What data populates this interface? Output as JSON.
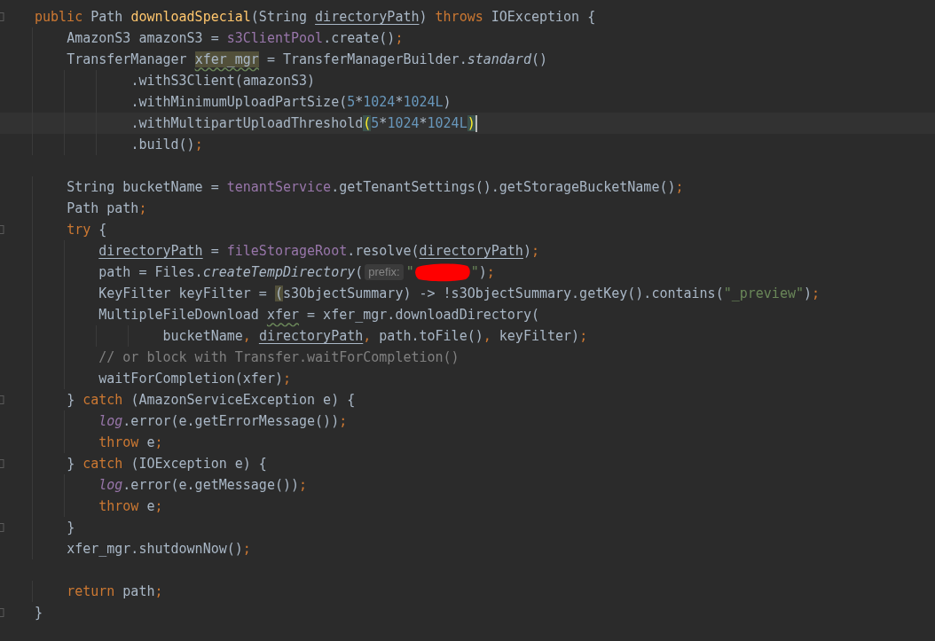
{
  "editor": {
    "lines": [
      {
        "current": false,
        "fold": true,
        "tokens": [
          {
            "kind": "keyword",
            "text": "public"
          },
          {
            "kind": "plain",
            "text": " Path "
          },
          {
            "kind": "declaration",
            "text": "downloadSpecial"
          },
          {
            "kind": "plain",
            "text": "(String "
          },
          {
            "kind": "parameter",
            "text": "directoryPath"
          },
          {
            "kind": "plain",
            "text": ") "
          },
          {
            "kind": "keyword",
            "text": "throws"
          },
          {
            "kind": "plain",
            "text": " IOException {"
          }
        ]
      },
      {
        "current": false,
        "fold": false,
        "tokens": [
          {
            "kind": "plain",
            "text": "    AmazonS3 amazonS3 = "
          },
          {
            "kind": "field",
            "text": "s3ClientPool"
          },
          {
            "kind": "plain",
            "text": ".create()"
          },
          {
            "kind": "punct",
            "text": ";"
          }
        ]
      },
      {
        "current": false,
        "fold": false,
        "tokens": [
          {
            "kind": "plain",
            "text": "    TransferManager "
          },
          {
            "kind": "occurrence",
            "text": "xfer_mgr"
          },
          {
            "kind": "plain",
            "text": " = TransferManagerBuilder."
          },
          {
            "kind": "static",
            "text": "standard"
          },
          {
            "kind": "plain",
            "text": "()"
          }
        ]
      },
      {
        "current": false,
        "fold": false,
        "tokens": [
          {
            "kind": "plain",
            "text": "            .withS3Client(amazonS3)"
          }
        ]
      },
      {
        "current": false,
        "fold": false,
        "tokens": [
          {
            "kind": "plain",
            "text": "            .withMinimumUploadPartSize("
          },
          {
            "kind": "number",
            "text": "5"
          },
          {
            "kind": "plain",
            "text": "*"
          },
          {
            "kind": "number",
            "text": "1024"
          },
          {
            "kind": "plain",
            "text": "*"
          },
          {
            "kind": "number",
            "text": "1024L"
          },
          {
            "kind": "plain",
            "text": ")"
          }
        ]
      },
      {
        "current": true,
        "fold": false,
        "tokens": [
          {
            "kind": "plain",
            "text": "            .withMultipartUploadThreshold"
          },
          {
            "kind": "brace-match",
            "text": "("
          },
          {
            "kind": "number",
            "text": "5"
          },
          {
            "kind": "plain",
            "text": "*"
          },
          {
            "kind": "number",
            "text": "1024"
          },
          {
            "kind": "plain",
            "text": "*"
          },
          {
            "kind": "number",
            "text": "1024L"
          },
          {
            "kind": "brace-match",
            "text": ")"
          }
        ]
      },
      {
        "current": false,
        "fold": false,
        "tokens": [
          {
            "kind": "plain",
            "text": "            .build()"
          },
          {
            "kind": "punct",
            "text": ";"
          }
        ]
      },
      {
        "current": false,
        "fold": false
      },
      {
        "current": false,
        "fold": false,
        "tokens": [
          {
            "kind": "plain",
            "text": "    String bucketName = "
          },
          {
            "kind": "field",
            "text": "tenantService"
          },
          {
            "kind": "plain",
            "text": ".getTenantSettings().getStorageBucketName()"
          },
          {
            "kind": "punct",
            "text": ";"
          }
        ]
      },
      {
        "current": false,
        "fold": false,
        "tokens": [
          {
            "kind": "plain",
            "text": "    Path path"
          },
          {
            "kind": "punct",
            "text": ";"
          }
        ]
      },
      {
        "current": false,
        "fold": true,
        "tokens": [
          {
            "kind": "keyword",
            "text": "    try"
          },
          {
            "kind": "plain",
            "text": " {"
          }
        ]
      },
      {
        "current": false,
        "fold": false,
        "tokens": [
          {
            "kind": "parameter",
            "text": "        directoryPath"
          },
          {
            "kind": "plain",
            "text": " = "
          },
          {
            "kind": "field",
            "text": "fileStorageRoot"
          },
          {
            "kind": "plain",
            "text": ".resolve("
          },
          {
            "kind": "parameter",
            "text": "directoryPath"
          },
          {
            "kind": "plain",
            "text": ")"
          },
          {
            "kind": "punct",
            "text": ";"
          }
        ]
      },
      {
        "current": false,
        "fold": false,
        "tokens": [
          {
            "kind": "plain",
            "text": "        path = Files."
          },
          {
            "kind": "static",
            "text": "createTempDirectory"
          },
          {
            "kind": "plain",
            "text": "("
          },
          {
            "kind": "hint",
            "text": "prefix:"
          },
          {
            "kind": "string",
            "text": "\""
          },
          {
            "kind": "redaction"
          },
          {
            "kind": "string",
            "text": "\""
          },
          {
            "kind": "plain",
            "text": ")"
          },
          {
            "kind": "punct",
            "text": ";"
          }
        ]
      },
      {
        "current": false,
        "fold": false,
        "tokens": [
          {
            "kind": "plain",
            "text": "        KeyFilter keyFilter = "
          },
          {
            "kind": "paren-highlight",
            "text": "("
          },
          {
            "kind": "plain",
            "text": "s3ObjectSummary) -> !s3ObjectSummary.getKey().contains("
          },
          {
            "kind": "string",
            "text": "\"_preview\""
          },
          {
            "kind": "plain",
            "text": ")"
          },
          {
            "kind": "punct",
            "text": ";"
          }
        ]
      },
      {
        "current": false,
        "fold": false,
        "tokens": [
          {
            "kind": "plain",
            "text": "        MultipleFileDownload "
          },
          {
            "kind": "typo",
            "text": "xfer"
          },
          {
            "kind": "plain",
            "text": " = xfer_mgr.downloadDirectory("
          }
        ]
      },
      {
        "current": false,
        "fold": false,
        "tokens": [
          {
            "kind": "plain",
            "text": "                bucketName"
          },
          {
            "kind": "punct",
            "text": ", "
          },
          {
            "kind": "parameter",
            "text": "directoryPath"
          },
          {
            "kind": "punct",
            "text": ", "
          },
          {
            "kind": "plain",
            "text": "path.toFile()"
          },
          {
            "kind": "punct",
            "text": ", "
          },
          {
            "kind": "plain",
            "text": "keyFilter)"
          },
          {
            "kind": "punct",
            "text": ";"
          }
        ]
      },
      {
        "current": false,
        "fold": false,
        "tokens": [
          {
            "kind": "comment",
            "text": "        // or block with Transfer.waitForCompletion()"
          }
        ]
      },
      {
        "current": false,
        "fold": false,
        "tokens": [
          {
            "kind": "plain",
            "text": "        waitForCompletion(xfer)"
          },
          {
            "kind": "punct",
            "text": ";"
          }
        ]
      },
      {
        "current": false,
        "fold": true,
        "tokens": [
          {
            "kind": "plain",
            "text": "    } "
          },
          {
            "kind": "keyword",
            "text": "catch"
          },
          {
            "kind": "plain",
            "text": " (AmazonServiceException e) {"
          }
        ]
      },
      {
        "current": false,
        "fold": false,
        "tokens": [
          {
            "kind": "static-field",
            "text": "        log"
          },
          {
            "kind": "plain",
            "text": ".error(e.getErrorMessage())"
          },
          {
            "kind": "punct",
            "text": ";"
          }
        ]
      },
      {
        "current": false,
        "fold": false,
        "tokens": [
          {
            "kind": "keyword",
            "text": "        throw"
          },
          {
            "kind": "plain",
            "text": " e"
          },
          {
            "kind": "punct",
            "text": ";"
          }
        ]
      },
      {
        "current": false,
        "fold": true,
        "tokens": [
          {
            "kind": "plain",
            "text": "    } "
          },
          {
            "kind": "keyword",
            "text": "catch"
          },
          {
            "kind": "plain",
            "text": " (IOException e) {"
          }
        ]
      },
      {
        "current": false,
        "fold": false,
        "tokens": [
          {
            "kind": "static-field",
            "text": "        log"
          },
          {
            "kind": "plain",
            "text": ".error(e.getMessage())"
          },
          {
            "kind": "punct",
            "text": ";"
          }
        ]
      },
      {
        "current": false,
        "fold": false,
        "tokens": [
          {
            "kind": "keyword",
            "text": "        throw"
          },
          {
            "kind": "plain",
            "text": " e"
          },
          {
            "kind": "punct",
            "text": ";"
          }
        ]
      },
      {
        "current": false,
        "fold": true,
        "tokens": [
          {
            "kind": "plain",
            "text": "    }"
          }
        ]
      },
      {
        "current": false,
        "fold": false,
        "tokens": [
          {
            "kind": "plain",
            "text": "    xfer_mgr.shutdownNow()"
          },
          {
            "kind": "punct",
            "text": ";"
          }
        ]
      },
      {
        "current": false,
        "fold": false
      },
      {
        "current": false,
        "fold": false,
        "tokens": [
          {
            "kind": "keyword",
            "text": "    return"
          },
          {
            "kind": "plain",
            "text": " path"
          },
          {
            "kind": "punct",
            "text": ";"
          }
        ]
      },
      {
        "current": false,
        "fold": true,
        "tokens": [
          {
            "kind": "plain",
            "text": "}"
          }
        ]
      }
    ]
  }
}
